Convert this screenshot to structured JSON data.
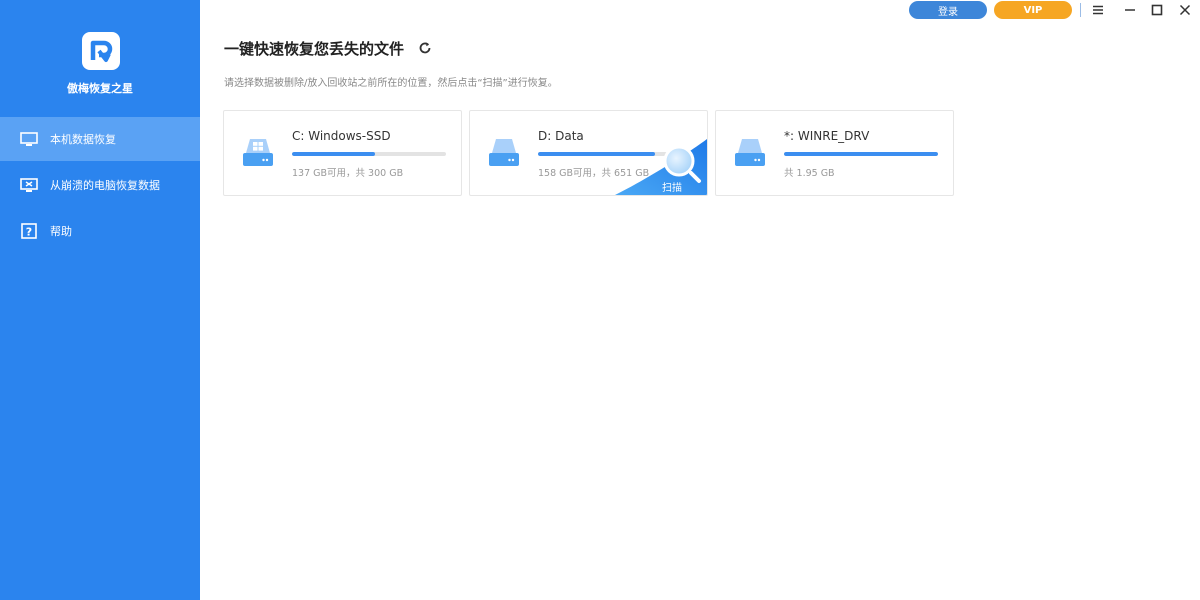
{
  "app": {
    "name": "傲梅恢复之星"
  },
  "sidebar": {
    "items": [
      {
        "label": "本机数据恢复",
        "icon": "monitor-icon",
        "active": true
      },
      {
        "label": "从崩溃的电脑恢复数据",
        "icon": "crashed-pc-icon",
        "active": false
      },
      {
        "label": "帮助",
        "icon": "help-icon",
        "active": false
      }
    ]
  },
  "header": {
    "login_label": "登录",
    "vip_label": "VIP",
    "controls": [
      "menu-icon",
      "minimize-icon",
      "maximize-icon",
      "close-icon"
    ]
  },
  "main": {
    "title": "一键快速恢复您丢失的文件",
    "subtitle": "请选择数据被删除/放入回收站之前所在的位置，然后点击“扫描”进行恢复。",
    "scan_label": "扫描",
    "drives": [
      {
        "name": "C: Windows-SSD",
        "info": "137 GB可用，共 300 GB",
        "used_fraction": 0.54,
        "icon": "windows-drive-icon"
      },
      {
        "name": "D: Data",
        "info": "158 GB可用，共 651 GB",
        "used_fraction": 0.76,
        "icon": "drive-icon"
      },
      {
        "name": "*: WINRE_DRV",
        "info": "共 1.95 GB",
        "used_fraction": 1.0,
        "icon": "drive-icon"
      }
    ]
  },
  "colors": {
    "sidebar": "#2b84ee",
    "accent": "#3b8ef0",
    "vip": "#f6a623",
    "login": "#3d86d9"
  }
}
